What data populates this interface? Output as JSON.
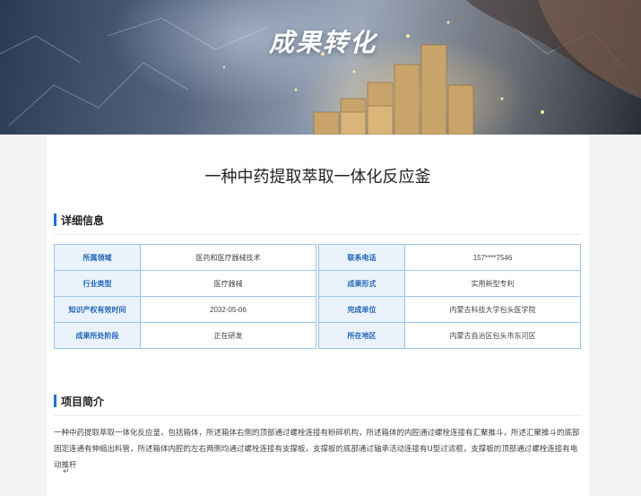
{
  "banner": {
    "title": "成果转化"
  },
  "page": {
    "title": "一种中药提取萃取一体化反应釜"
  },
  "details": {
    "heading": "详细信息",
    "left": [
      {
        "label": "所属领域",
        "value": "医药和医疗器械技术"
      },
      {
        "label": "行业类型",
        "value": "医疗器械"
      },
      {
        "label": "知识产权有效时间",
        "value": "2032-05-06"
      },
      {
        "label": "成果所处阶段",
        "value": "正在研发"
      }
    ],
    "right": [
      {
        "label": "联系电话",
        "value": "157****7546"
      },
      {
        "label": "成果形式",
        "value": "实用新型专利"
      },
      {
        "label": "完成单位",
        "value": "内蒙古科技大学包头医学院"
      },
      {
        "label": "所在地区",
        "value": "内蒙古自治区包头市东河区"
      }
    ]
  },
  "intro": {
    "heading": "项目简介",
    "text": "一种中药提取萃取一体化反应釜，包括箱体，所述箱体右侧的顶部通过螺栓连接有粉碎机构，所述箱体的内腔通过螺栓连接有汇聚推斗，所述汇聚推斗的底部固定连通有伸缩出料管，所述箱体内腔的左右两侧均通过螺栓连接有支撑板，支撑板的底部通过轴承活动连接有U型过滤框，支撑板的顶部通过螺栓连接有电动推杆",
    "para_mark": "↵"
  }
}
